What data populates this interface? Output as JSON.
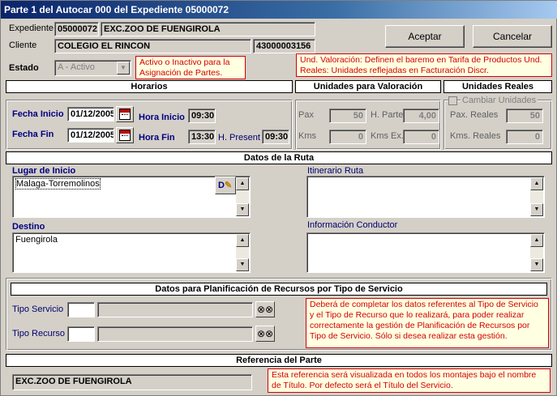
{
  "window": {
    "title": "Parte 1 del Autocar 000 del Expediente 05000072"
  },
  "header": {
    "expediente_label": "Expediente",
    "expediente_code": "05000072",
    "expediente_name": "EXC.ZOO DE FUENGIROLA",
    "cliente_label": "Cliente",
    "cliente_name": "COLEGIO EL RINCON",
    "cliente_code": "43000003156",
    "estado_label": "Estado",
    "estado_value": "A - Activo",
    "estado_note": "Activo o Inactivo para la Asignación de Partes.",
    "units_note": "Und. Valoración: Definen el baremo en Tarifa de Productos Und. Reales: Unidades reflejadas en Facturación Discr."
  },
  "buttons": {
    "accept": "Aceptar",
    "cancel": "Cancelar"
  },
  "horarios": {
    "title": "Horarios",
    "fecha_inicio_label": "Fecha Inicio",
    "fecha_inicio": "01/12/2005",
    "hora_inicio_label": "Hora Inicio",
    "hora_inicio": "09:30",
    "fecha_fin_label": "Fecha Fin",
    "fecha_fin": "01/12/2005",
    "hora_fin_label": "Hora Fin",
    "hora_fin": "13:30",
    "h_present_label": "H. Present",
    "h_present": "09:30"
  },
  "valoracion": {
    "title": "Unidades para Valoración",
    "pax_label": "Pax",
    "pax": "50",
    "h_parte_label": "H. Parte",
    "h_parte": "4,00",
    "kms_label": "Kms",
    "kms": "0",
    "kms_ex_label": "Kms Ex.",
    "kms_ex": "0"
  },
  "reales": {
    "title": "Unidades Reales",
    "cambiar_label": "Cambiar Unidades",
    "pax_label": "Pax. Reales",
    "pax": "50",
    "kms_label": "Kms. Reales",
    "kms": "0"
  },
  "ruta": {
    "title": "Datos de la Ruta",
    "lugar_label": "Lugar de Inicio",
    "lugar_value": "Malaga-Torremolinos",
    "itinerario_label": "Itinerario Ruta",
    "destino_label": "Destino",
    "destino_value": "Fuengirola",
    "conductor_label": "Información Conductor"
  },
  "planificacion": {
    "title": "Datos para Planificación de Recursos por Tipo de Servicio",
    "tipo_servicio_label": "Tipo Servicio",
    "tipo_recurso_label": "Tipo Recurso",
    "note": "Deberá de completar los datos referentes al Tipo de Servicio y el Tipo de Recurso que lo realizará, para poder realizar correctamente la gestión de Planificación de Recursos por Tipo de Servicio. Sólo si desea realizar esta gestión."
  },
  "referencia": {
    "title": "Referencia del Parte",
    "value": "EXC.ZOO DE FUENGIROLA",
    "note": "Esta referencia será visualizada en todos los montajes bajo el nombre de Título. Por defecto será el Título del Servicio."
  },
  "icons": {
    "calendar": "calendar-icon",
    "binoculars": "binoculars-icon",
    "edit": "edit-document-icon"
  }
}
